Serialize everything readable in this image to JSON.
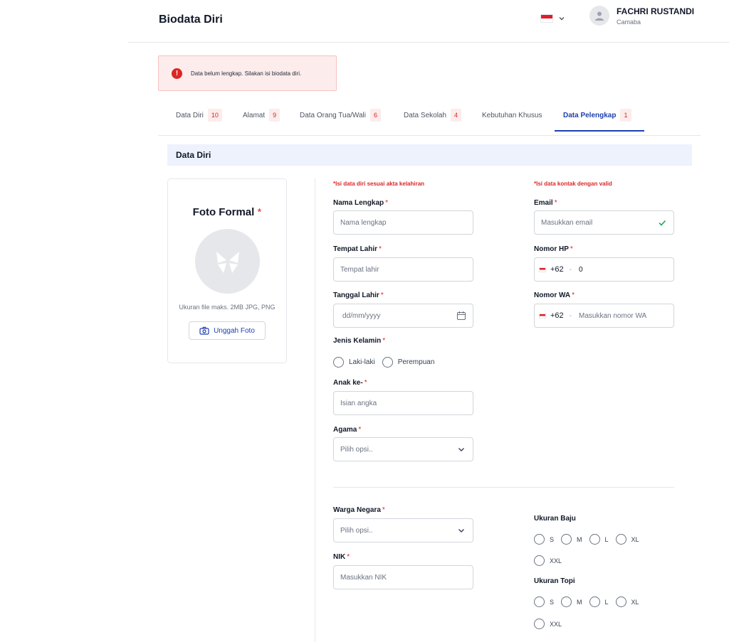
{
  "header": {
    "title": "Biodata Diri",
    "user_name": "FACHRI RUSTANDI",
    "user_role": "Camaba"
  },
  "alert": {
    "icon": "!",
    "text": "Data belum lengkap. Silakan isi biodata diri."
  },
  "tabs": [
    {
      "label": "Data Diri",
      "badge": "10"
    },
    {
      "label": "Alamat",
      "badge": "9"
    },
    {
      "label": "Data Orang Tua/Wali",
      "badge": "6"
    },
    {
      "label": "Data Sekolah",
      "badge": "4"
    },
    {
      "label": "Kebutuhan Khusus",
      "badge": ""
    },
    {
      "label": "Data Pelengkap",
      "badge": "1",
      "active": true
    }
  ],
  "section": {
    "title": "Data Diri"
  },
  "photo": {
    "title": "Foto Formal",
    "hint": "Ukuran file maks. 2MB JPG, PNG",
    "upload_label": "Unggah Foto"
  },
  "notes": {
    "left": "*Isi data diri sesuai akta kelahiran",
    "right": "*Isi data kontak dengan valid"
  },
  "required_mark": "*",
  "fields": {
    "nama": {
      "label": "Nama Lengkap",
      "placeholder": "Nama lengkap"
    },
    "tempat": {
      "label": "Tempat Lahir",
      "placeholder": "Tempat lahir"
    },
    "tanggal": {
      "label": "Tanggal Lahir",
      "placeholder": "dd/mm/yyyy"
    },
    "jenis_kelamin": {
      "label": "Jenis Kelamin",
      "options": [
        "Laki-laki",
        "Perempuan"
      ]
    },
    "anak_ke": {
      "label": "Anak ke-",
      "placeholder": "Isian angka"
    },
    "agama": {
      "label": "Agama",
      "placeholder": "Pilih opsi.."
    },
    "email": {
      "label": "Email",
      "placeholder": "Masukkan email"
    },
    "hp": {
      "label": "Nomor HP",
      "code": "+62",
      "dash": "-",
      "value": "0"
    },
    "wa": {
      "label": "Nomor WA",
      "code": "+62",
      "dash": "-",
      "placeholder": "Masukkan nomor WA"
    },
    "warga_negara": {
      "label": "Warga Negara",
      "placeholder": "Pilih opsi.."
    },
    "nik": {
      "label": "NIK",
      "placeholder": "Masukkan NIK"
    },
    "ukuran_baju": {
      "label": "Ukuran Baju",
      "options": [
        "S",
        "M",
        "L",
        "XL",
        "XXL"
      ]
    },
    "ukuran_topi": {
      "label": "Ukuran Topi",
      "options": [
        "S",
        "M",
        "L",
        "XL",
        "XXL"
      ]
    }
  },
  "colors": {
    "accent": "#1e40af",
    "error": "#dc2626",
    "section_bg": "#eef2fd",
    "valid": "#16a34a"
  },
  "icons": [
    "chevron-down-icon",
    "user-icon",
    "alert-icon",
    "image-placeholder-icon",
    "camera-icon",
    "calendar-icon",
    "check-icon"
  ]
}
